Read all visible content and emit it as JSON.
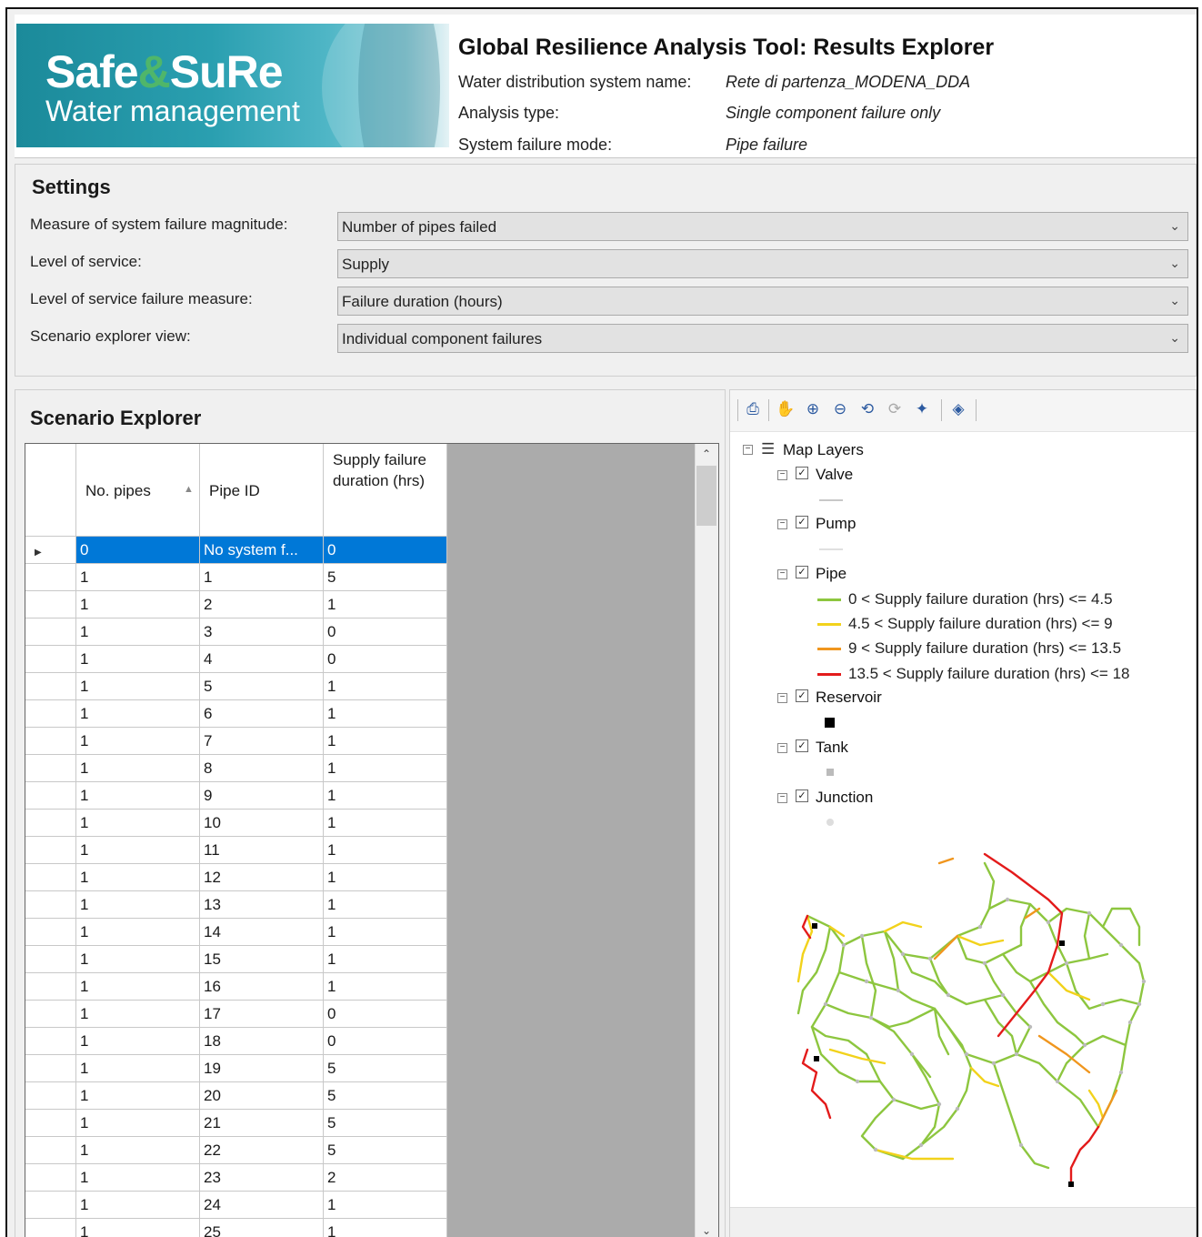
{
  "header": {
    "logo_main_a": "Safe",
    "logo_main_amp": "&",
    "logo_main_b": "SuRe",
    "logo_sub": "Water management",
    "title": "Global Resilience Analysis Tool: Results Explorer",
    "info": [
      {
        "label": "Water distribution system name:",
        "value": "Rete di partenza_MODENA_DDA"
      },
      {
        "label": "Analysis type:",
        "value": "Single component failure only"
      },
      {
        "label": "System failure mode:",
        "value": "Pipe failure"
      }
    ]
  },
  "settings": {
    "title": "Settings",
    "fields": [
      {
        "label": "Measure of system failure magnitude:",
        "value": "Number of pipes failed"
      },
      {
        "label": "Level of service:",
        "value": "Supply"
      },
      {
        "label": "Level of service failure measure:",
        "value": "Failure duration (hours)"
      },
      {
        "label": "Scenario explorer view:",
        "value": "Individual component failures"
      }
    ]
  },
  "scenario": {
    "title": "Scenario Explorer",
    "columns": [
      "No. pipes",
      "Pipe ID",
      "Supply failure duration (hrs)"
    ],
    "rows": [
      [
        "0",
        "No system f...",
        "0"
      ],
      [
        "1",
        "1",
        "5"
      ],
      [
        "1",
        "2",
        "1"
      ],
      [
        "1",
        "3",
        "0"
      ],
      [
        "1",
        "4",
        "0"
      ],
      [
        "1",
        "5",
        "1"
      ],
      [
        "1",
        "6",
        "1"
      ],
      [
        "1",
        "7",
        "1"
      ],
      [
        "1",
        "8",
        "1"
      ],
      [
        "1",
        "9",
        "1"
      ],
      [
        "1",
        "10",
        "1"
      ],
      [
        "1",
        "11",
        "1"
      ],
      [
        "1",
        "12",
        "1"
      ],
      [
        "1",
        "13",
        "1"
      ],
      [
        "1",
        "14",
        "1"
      ],
      [
        "1",
        "15",
        "1"
      ],
      [
        "1",
        "16",
        "1"
      ],
      [
        "1",
        "17",
        "0"
      ],
      [
        "1",
        "18",
        "0"
      ],
      [
        "1",
        "19",
        "5"
      ],
      [
        "1",
        "20",
        "5"
      ],
      [
        "1",
        "21",
        "5"
      ],
      [
        "1",
        "22",
        "5"
      ],
      [
        "1",
        "23",
        "2"
      ],
      [
        "1",
        "24",
        "1"
      ],
      [
        "1",
        "25",
        "1"
      ]
    ],
    "selected_row": 0
  },
  "map": {
    "toolbar_icons": [
      "print-icon",
      "pan-icon",
      "zoom-in-icon",
      "zoom-out-icon",
      "back-icon",
      "forward-icon",
      "identify-icon",
      "full-extent-icon"
    ],
    "root_label": "Map Layers",
    "layers": [
      {
        "name": "Valve",
        "checked": true
      },
      {
        "name": "Pump",
        "checked": true
      },
      {
        "name": "Pipe",
        "checked": true
      },
      {
        "name": "Reservoir",
        "checked": true
      },
      {
        "name": "Tank",
        "checked": true
      },
      {
        "name": "Junction",
        "checked": true
      }
    ],
    "pipe_legend": [
      {
        "label": "0 < Supply failure duration (hrs) <= 4.5",
        "color": "#8dc63f"
      },
      {
        "label": "4.5 < Supply failure duration (hrs) <= 9",
        "color": "#f2d21b"
      },
      {
        "label": "9 < Supply failure duration (hrs) <= 13.5",
        "color": "#f0961e"
      },
      {
        "label": "13.5 < Supply failure duration (hrs) <= 18",
        "color": "#e31b1b"
      }
    ]
  }
}
